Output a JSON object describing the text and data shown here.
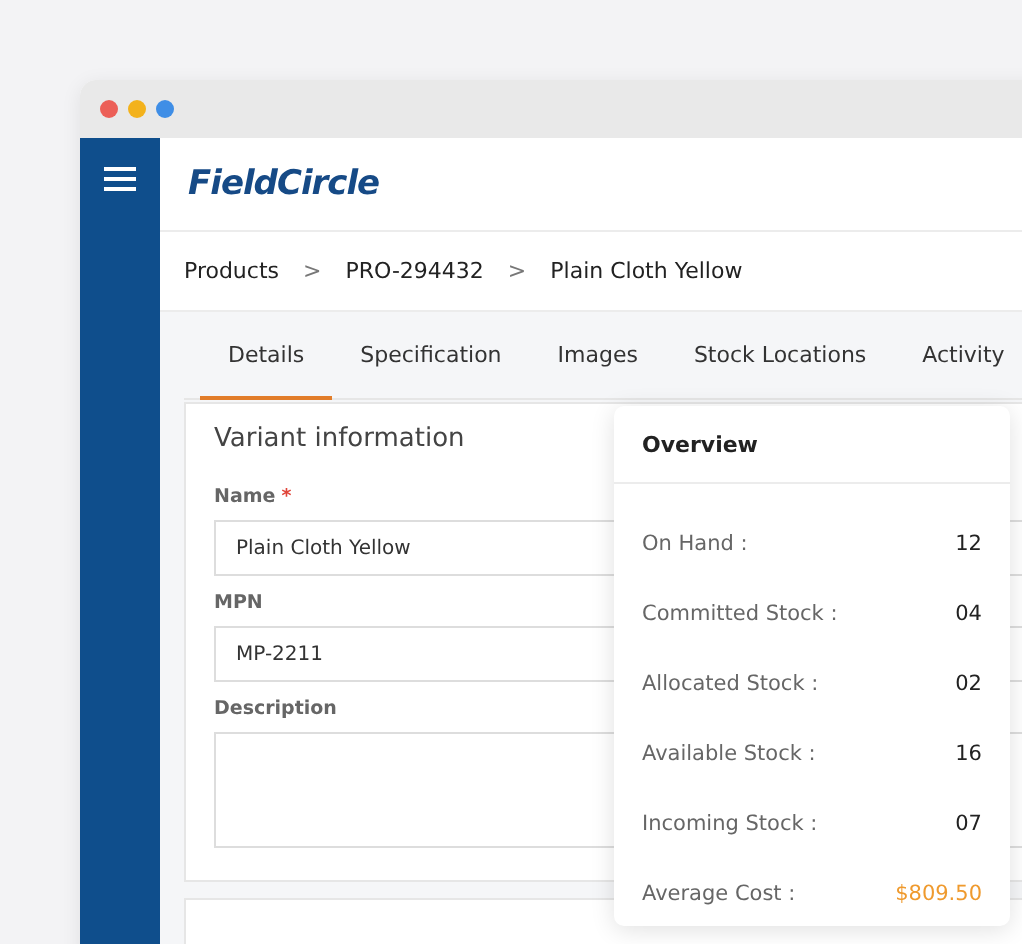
{
  "logo": "FieldCircle",
  "breadcrumb": [
    "Products",
    "PRO-294432",
    "Plain Cloth Yellow"
  ],
  "breadcrumb_separator": ">",
  "tabs": [
    {
      "label": "Details",
      "selected": true
    },
    {
      "label": "Specification",
      "selected": false
    },
    {
      "label": "Images",
      "selected": false
    },
    {
      "label": "Stock Locations",
      "selected": false
    },
    {
      "label": "Activity",
      "selected": false
    }
  ],
  "section_title": "Variant information",
  "fields": [
    {
      "label": "Name",
      "required_mark": "*",
      "kind": "input",
      "value": "Plain Cloth Yellow"
    },
    {
      "label": "MPN",
      "kind": "input",
      "value": "MP-2211"
    },
    {
      "label": "Description",
      "kind": "textarea"
    }
  ],
  "overview": {
    "title": "Overview",
    "rows": [
      {
        "label": "On Hand :",
        "value": "12",
        "kind": "count"
      },
      {
        "label": "Committed Stock :",
        "value": "04",
        "kind": "count"
      },
      {
        "label": "Allocated Stock :",
        "value": "02",
        "kind": "count"
      },
      {
        "label": "Available Stock :",
        "value": "16",
        "kind": "count"
      },
      {
        "label": "Incoming Stock :",
        "value": "07",
        "kind": "count"
      },
      {
        "label": "Average Cost :",
        "value": "$809.50",
        "kind": "currency"
      }
    ]
  }
}
